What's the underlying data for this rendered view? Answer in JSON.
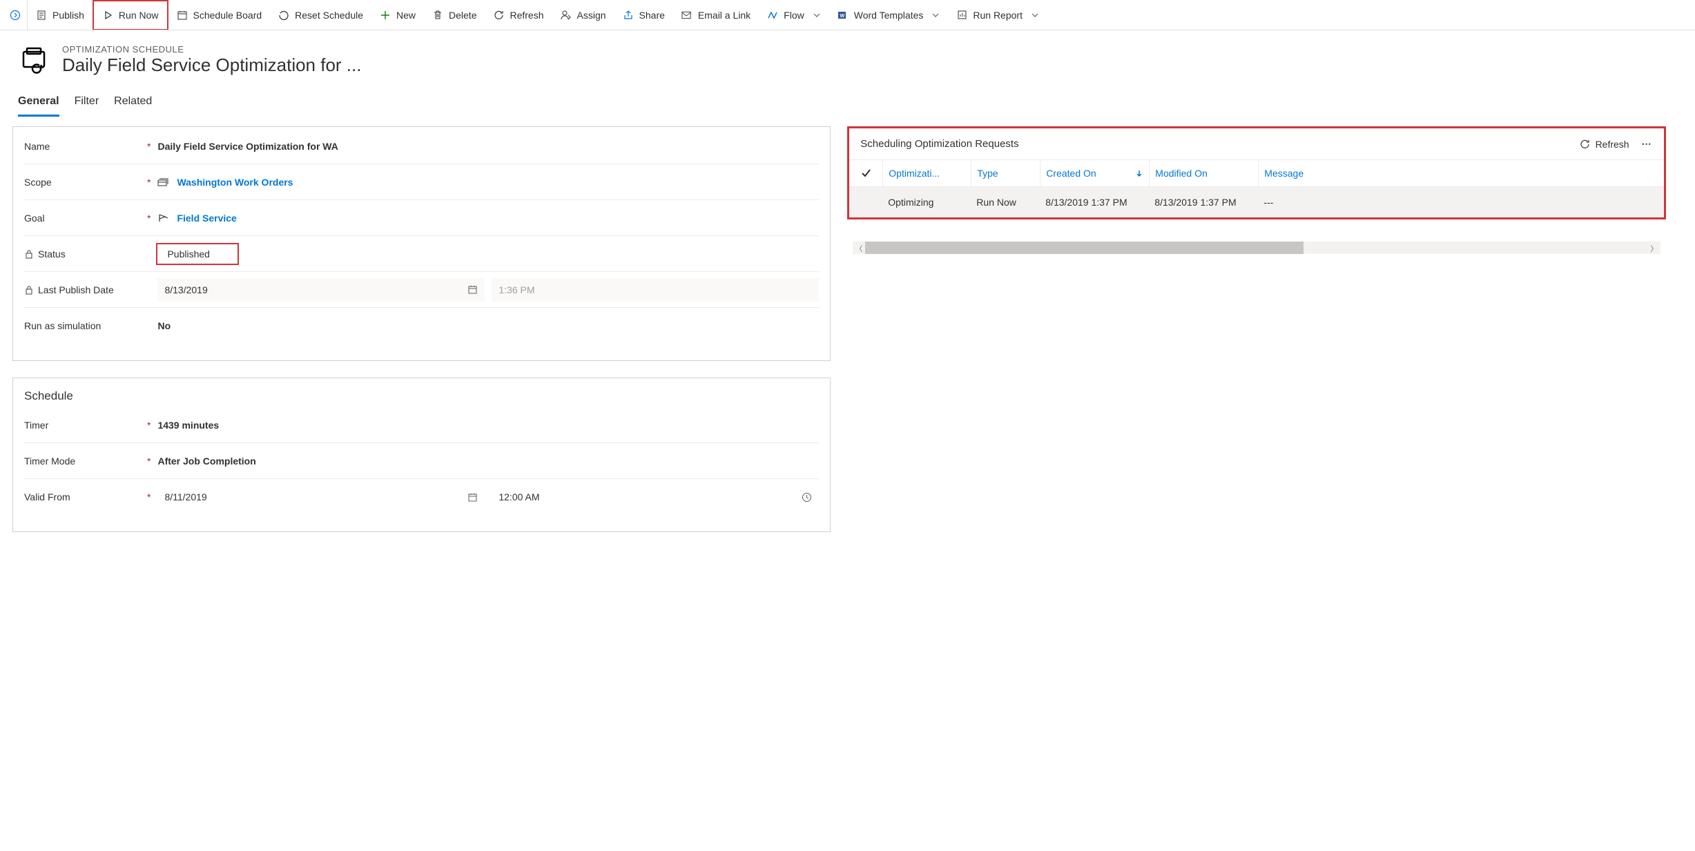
{
  "commandBar": {
    "publish": "Publish",
    "runNow": "Run Now",
    "scheduleBoard": "Schedule Board",
    "resetSchedule": "Reset Schedule",
    "new": "New",
    "delete": "Delete",
    "refresh": "Refresh",
    "assign": "Assign",
    "share": "Share",
    "emailLink": "Email a Link",
    "flow": "Flow",
    "wordTemplates": "Word Templates",
    "runReport": "Run Report"
  },
  "header": {
    "entity": "OPTIMIZATION SCHEDULE",
    "title": "Daily Field Service Optimization for ..."
  },
  "tabs": {
    "general": "General",
    "filter": "Filter",
    "related": "Related"
  },
  "fields": {
    "nameLabel": "Name",
    "nameValue": "Daily Field Service Optimization for WA",
    "scopeLabel": "Scope",
    "scopeValue": "Washington Work Orders",
    "goalLabel": "Goal",
    "goalValue": "Field Service",
    "statusLabel": "Status",
    "statusValue": "Published",
    "lastPublishLabel": "Last Publish Date",
    "lastPublishDate": "8/13/2019",
    "lastPublishTime": "1:36 PM",
    "runSimLabel": "Run as simulation",
    "runSimValue": "No"
  },
  "schedule": {
    "title": "Schedule",
    "timerLabel": "Timer",
    "timerValue": "1439 minutes",
    "timerModeLabel": "Timer Mode",
    "timerModeValue": "After Job Completion",
    "validFromLabel": "Valid From",
    "validFromDate": "8/11/2019",
    "validFromTime": "12:00 AM"
  },
  "subgrid": {
    "title": "Scheduling Optimization Requests",
    "refresh": "Refresh",
    "columns": {
      "opt": "Optimizati...",
      "type": "Type",
      "created": "Created On",
      "modified": "Modified On",
      "message": "Message"
    },
    "row": {
      "opt": "Optimizing",
      "type": "Run Now",
      "created": "8/13/2019 1:37 PM",
      "modified": "8/13/2019 1:37 PM",
      "message": "---"
    }
  }
}
